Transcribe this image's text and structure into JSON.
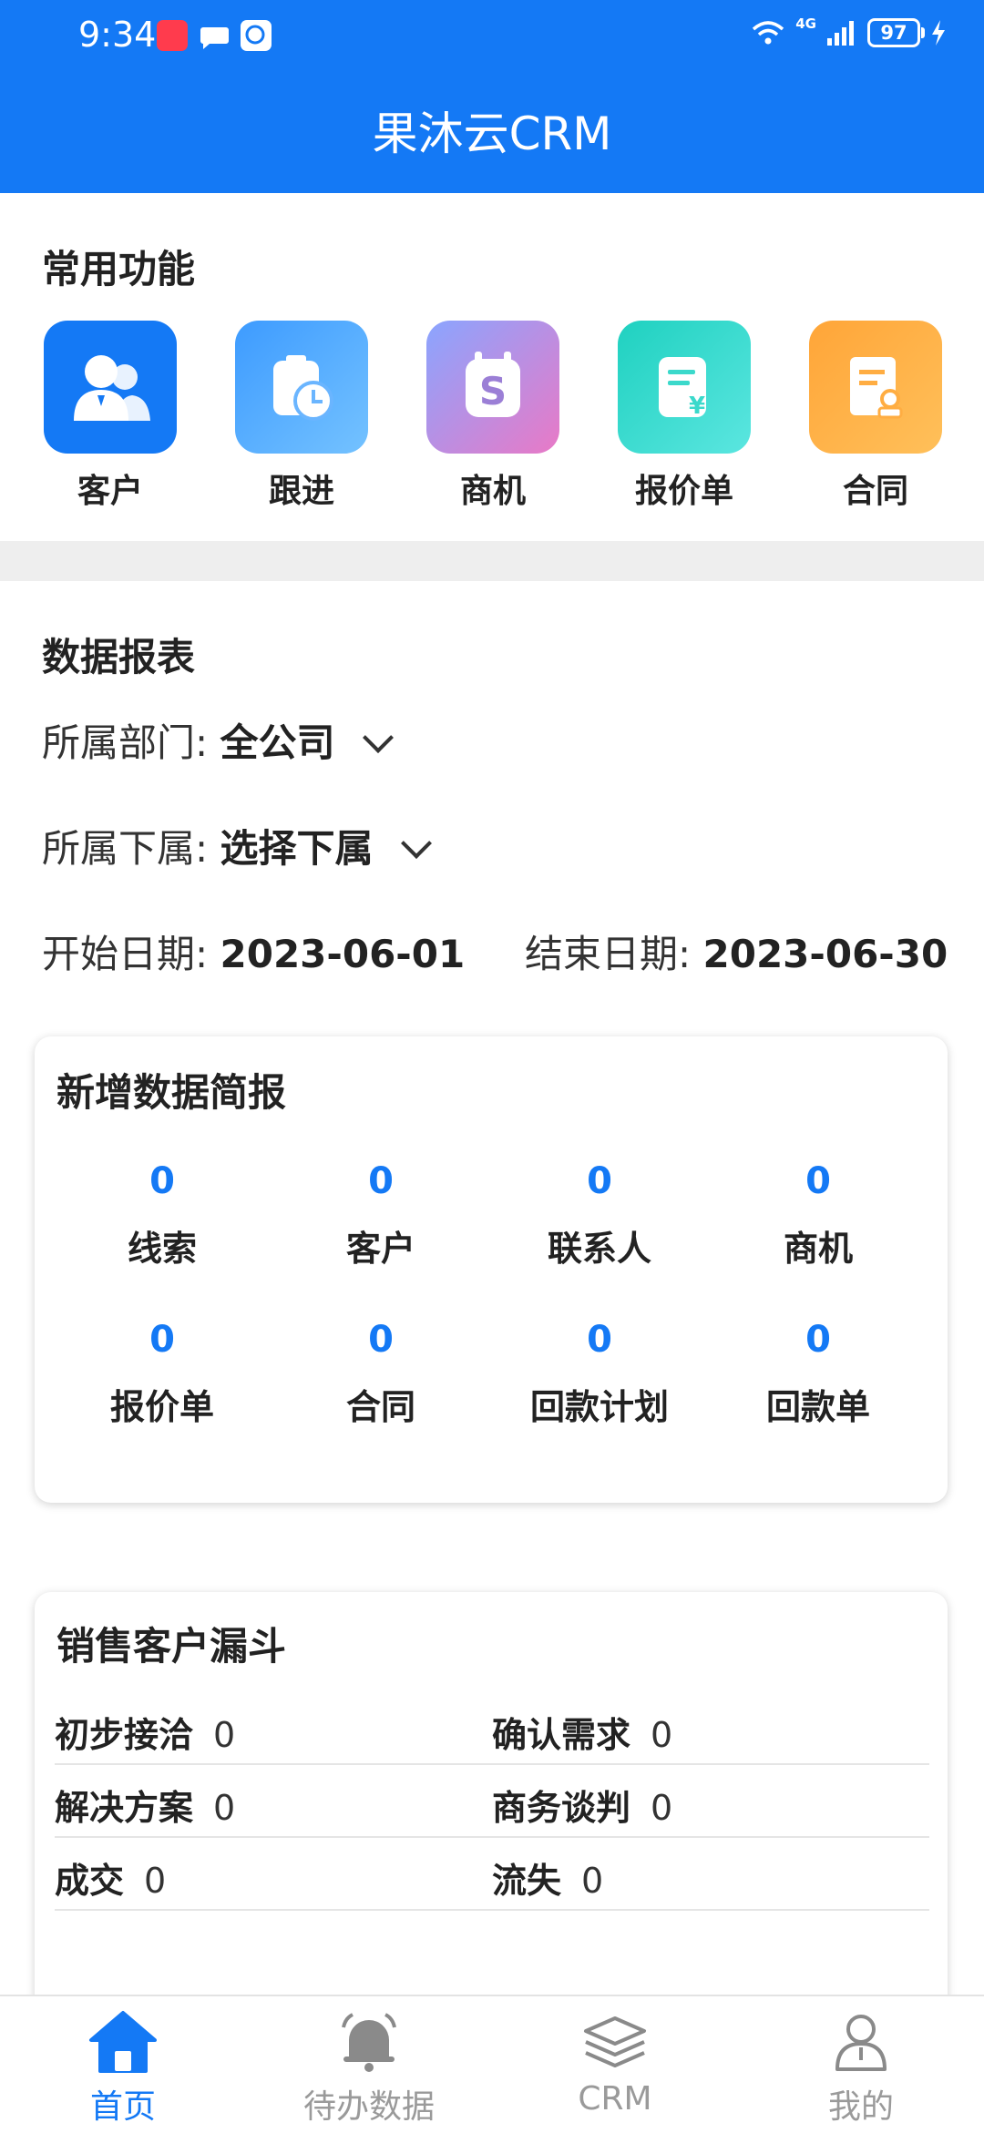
{
  "status_bar": {
    "time": "9:34",
    "battery": "97",
    "network": "4G"
  },
  "header": {
    "title": "果沐云CRM"
  },
  "quick_functions": {
    "title": "常用功能",
    "items": [
      {
        "label": "客户",
        "icon": "customer-icon",
        "color": "#1479f5"
      },
      {
        "label": "跟进",
        "icon": "follow-up-icon",
        "color": "#4aa8ff"
      },
      {
        "label": "商机",
        "icon": "opportunity-icon",
        "color": "#b58ce6"
      },
      {
        "label": "报价单",
        "icon": "quotation-icon",
        "color": "#2fd6c6"
      },
      {
        "label": "合同",
        "icon": "contract-icon",
        "color": "#ff9a2e"
      }
    ]
  },
  "report": {
    "title": "数据报表",
    "department_label": "所属部门:",
    "department_value": "全公司",
    "subordinate_label": "所属下属:",
    "subordinate_value": "选择下属",
    "start_label": "开始日期:",
    "start_value": "2023-06-01",
    "end_label": "结束日期:",
    "end_value": "2023-06-30"
  },
  "new_data_brief": {
    "title": "新增数据简报",
    "stats": [
      {
        "value": "0",
        "label": "线索"
      },
      {
        "value": "0",
        "label": "客户"
      },
      {
        "value": "0",
        "label": "联系人"
      },
      {
        "value": "0",
        "label": "商机"
      },
      {
        "value": "0",
        "label": "报价单"
      },
      {
        "value": "0",
        "label": "合同"
      },
      {
        "value": "0",
        "label": "回款计划"
      },
      {
        "value": "0",
        "label": "回款单"
      }
    ]
  },
  "sales_funnel": {
    "title": "销售客户漏斗",
    "rows": [
      [
        {
          "name": "初步接洽",
          "value": "0"
        },
        {
          "name": "确认需求",
          "value": "0"
        }
      ],
      [
        {
          "name": "解决方案",
          "value": "0"
        },
        {
          "name": "商务谈判",
          "value": "0"
        }
      ],
      [
        {
          "name": "成交",
          "value": "0"
        },
        {
          "name": "流失",
          "value": "0"
        }
      ]
    ]
  },
  "bottom_nav": {
    "items": [
      {
        "label": "首页",
        "icon": "home-icon",
        "active": true
      },
      {
        "label": "待办数据",
        "icon": "bell-icon",
        "active": false
      },
      {
        "label": "CRM",
        "icon": "layers-icon",
        "active": false
      },
      {
        "label": "我的",
        "icon": "profile-icon",
        "active": false
      }
    ]
  },
  "colors": {
    "primary": "#1479f5",
    "divider": "#eeeeee"
  }
}
